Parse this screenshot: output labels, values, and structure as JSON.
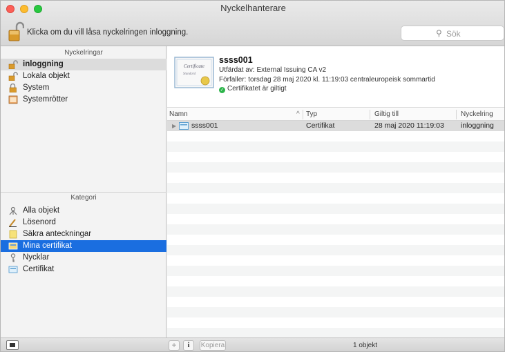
{
  "window": {
    "title": "Nyckelhanterare"
  },
  "toolbar": {
    "lock_label": "Klicka om du vill låsa nyckelringen inloggning.",
    "search_placeholder": "Sök"
  },
  "sidebar": {
    "keychains_header": "Nyckelringar",
    "keychains": [
      {
        "label": "inloggning",
        "icon": "unlocked-padlock-icon",
        "active": true
      },
      {
        "label": "Lokala objekt",
        "icon": "unlocked-padlock-icon"
      },
      {
        "label": "System",
        "icon": "locked-padlock-icon"
      },
      {
        "label": "Systemrötter",
        "icon": "cabinet-icon"
      }
    ],
    "category_header": "Kategori",
    "categories": [
      {
        "label": "Alla objekt",
        "icon": "all-items-icon"
      },
      {
        "label": "Lösenord",
        "icon": "pencil-key-icon"
      },
      {
        "label": "Säkra anteckningar",
        "icon": "note-icon"
      },
      {
        "label": "Mina certifikat",
        "icon": "my-certificate-icon",
        "selected": true
      },
      {
        "label": "Nycklar",
        "icon": "key-icon"
      },
      {
        "label": "Certifikat",
        "icon": "certificate-icon"
      }
    ]
  },
  "details": {
    "name": "ssss001",
    "issuer": "Utfärdat av: External Issuing CA v2",
    "expiry": "Förfaller: torsdag 28 maj 2020 kl. 11:19:03 centraleuropeisk sommartid",
    "status": "Certifikatet är giltigt",
    "thumbnail_title": "Certificate",
    "thumbnail_subtitle": "Standard"
  },
  "table": {
    "columns": [
      "Namn",
      "Typ",
      "Giltig till",
      "Nyckelring"
    ],
    "rows": [
      {
        "name": "ssss001",
        "type": "Certifikat",
        "valid_until": "28 maj 2020 11:19:03",
        "keychain": "inloggning"
      }
    ]
  },
  "bottombar": {
    "add": "+",
    "info": "i",
    "copy": "Kopiera",
    "count": "1 objekt"
  },
  "colors": {
    "selection": "#1a6ee0",
    "valid_green": "#2cb44a"
  }
}
